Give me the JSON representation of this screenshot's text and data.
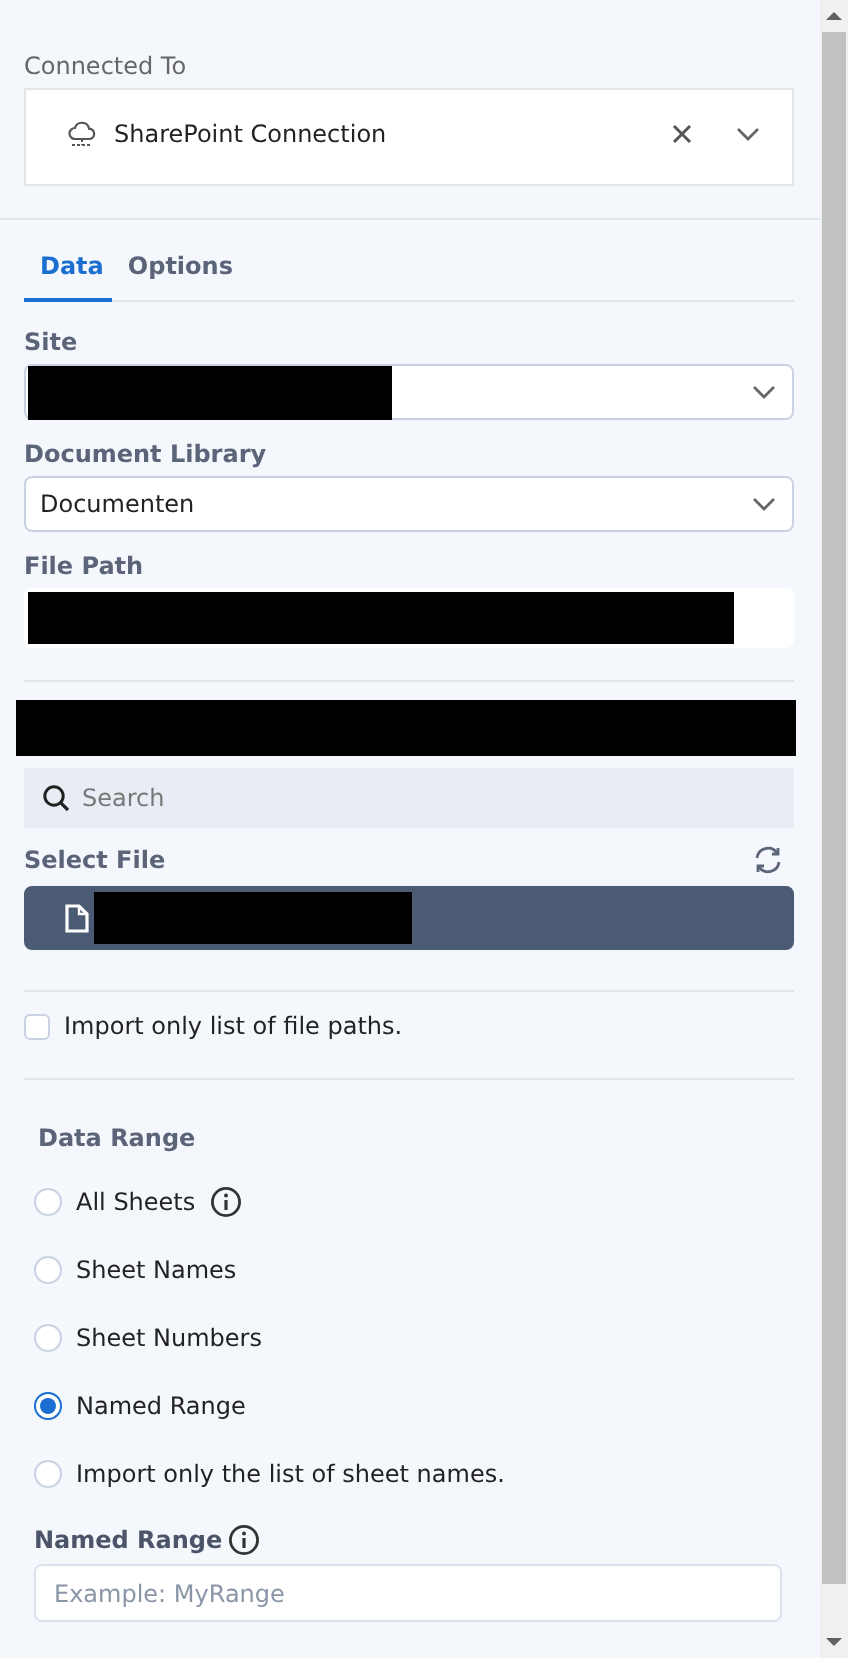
{
  "connection": {
    "label": "Connected To",
    "value": "SharePoint Connection"
  },
  "tabs": [
    {
      "label": "Data",
      "selected": true
    },
    {
      "label": "Options",
      "selected": false
    }
  ],
  "site": {
    "label": "Site"
  },
  "document_library": {
    "label": "Document Library",
    "value": "Documenten"
  },
  "file_path": {
    "label": "File Path"
  },
  "search": {
    "placeholder": "Search"
  },
  "select_file": {
    "label": "Select File",
    "files": [
      {
        "selected": true
      }
    ]
  },
  "import_file_paths": {
    "label": "Import only list of file paths.",
    "checked": false
  },
  "data_range": {
    "title": "Data Range",
    "options": [
      {
        "label": "All Sheets",
        "selected": false,
        "info": true
      },
      {
        "label": "Sheet Names",
        "selected": false,
        "info": false
      },
      {
        "label": "Sheet Numbers",
        "selected": false,
        "info": false
      },
      {
        "label": "Named Range",
        "selected": true,
        "info": false
      },
      {
        "label": "Import only the list of sheet names.",
        "selected": false,
        "info": false
      }
    ]
  },
  "named_range": {
    "label": "Named Range",
    "placeholder": "Example: MyRange"
  }
}
